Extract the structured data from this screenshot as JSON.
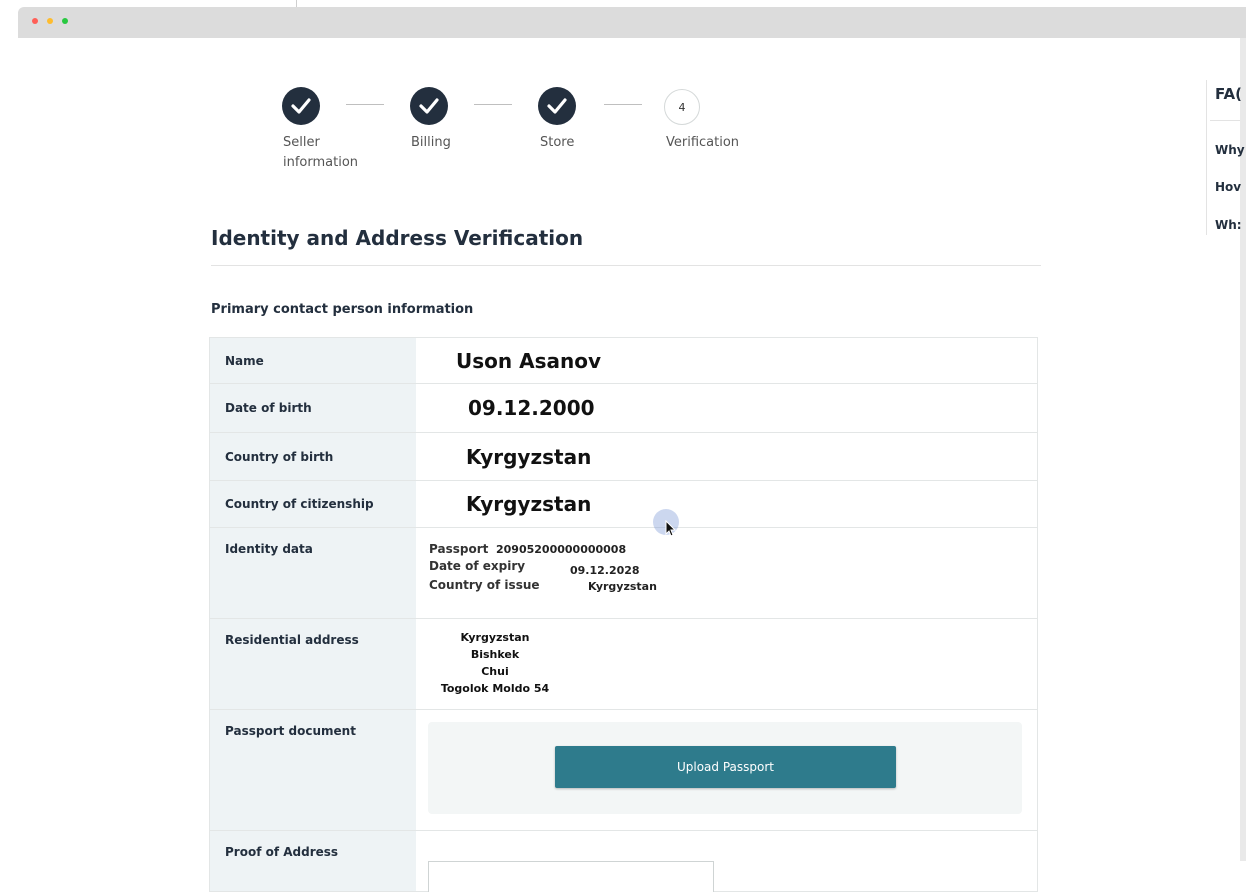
{
  "stepper": {
    "steps": [
      {
        "label_line1": "Seller",
        "label_line2": "information",
        "status": "complete",
        "icon": "check-icon"
      },
      {
        "label_line1": "Billing",
        "label_line2": "",
        "status": "complete",
        "icon": "check-icon"
      },
      {
        "label_line1": "Store",
        "label_line2": "",
        "status": "complete",
        "icon": "check-icon"
      },
      {
        "label_line1": "Verification",
        "label_line2": "",
        "status": "current",
        "number": "4"
      }
    ]
  },
  "page": {
    "title": "Identity and Address Verification",
    "section_title": "Primary contact person information"
  },
  "table": {
    "name": {
      "label": "Name",
      "value": "Uson Asanov"
    },
    "dob": {
      "label": "Date of birth",
      "value": "09.12.2000"
    },
    "cob": {
      "label": "Country of birth",
      "value": "Kyrgyzstan"
    },
    "coc": {
      "label": "Country of citizenship",
      "value": "Kyrgyzstan"
    },
    "identity": {
      "label": "Identity data",
      "passport_label": "Passport",
      "passport_value": "20905200000000008",
      "expiry_label": "Date of expiry",
      "expiry_value": "09.12.2028",
      "issue_label": "Country of issue",
      "issue_value": "Kyrgyzstan"
    },
    "address": {
      "label": "Residential address",
      "lines": [
        "Kyrgyzstan",
        "Bishkek",
        "Chui",
        "Togolok Moldo 54"
      ]
    },
    "passport_doc": {
      "label": "Passport document",
      "button": "Upload Passport"
    },
    "proof": {
      "label": "Proof of Address"
    }
  },
  "faq": {
    "title": "FA(",
    "items": [
      "Why",
      "Hov",
      "Wh:"
    ]
  },
  "colors": {
    "step_complete": "#232f3e",
    "upload_button": "#2e7b8c",
    "label_cell_bg": "#eef3f5"
  }
}
